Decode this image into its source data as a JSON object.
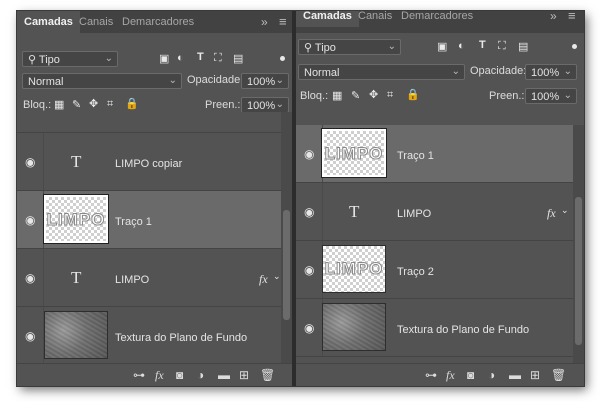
{
  "panel_left": {
    "tabs": [
      "Camadas",
      "Canais",
      "Demarcadores"
    ],
    "collapse": "»",
    "menu": "≡",
    "filter_label": "Tipo",
    "blend_mode": "Normal",
    "opacity_label": "Opacidade:",
    "opacity_value": "100%",
    "lock_label": "Bloq.:",
    "fill_label": "Preen.:",
    "fill_value": "100%",
    "layers": [
      {
        "type": "text",
        "name": "LIMPO copiar",
        "fx": ""
      },
      {
        "type": "image",
        "name": "Traço 1",
        "thumb_text": "LIMPO",
        "selected": true
      },
      {
        "type": "text",
        "name": "LIMPO",
        "fx": "fx"
      },
      {
        "type": "texture",
        "name": "Textura do Plano de Fundo"
      }
    ]
  },
  "panel_right": {
    "tabs": [
      "Camadas",
      "Canais",
      "Demarcadores"
    ],
    "collapse": "»",
    "menu": "≡",
    "filter_label": "Tipo",
    "blend_mode": "Normal",
    "opacity_label": "Opacidade:",
    "opacity_value": "100%",
    "lock_label": "Bloq.:",
    "fill_label": "Preen.:",
    "fill_value": "100%",
    "layers": [
      {
        "type": "image",
        "name": "Traço 1",
        "thumb_text": "LIMPO",
        "selected": true
      },
      {
        "type": "text",
        "name": "LIMPO",
        "fx": "fx"
      },
      {
        "type": "image",
        "name": "Traço 2",
        "thumb_text": "LIMPO"
      },
      {
        "type": "texture",
        "name": "Textura do Plano de Fundo"
      }
    ]
  },
  "glyphs": {
    "search": "⚲",
    "chevron": "⌄",
    "eye": "◉",
    "text_layer": "T",
    "fx": "fx",
    "move": "✥",
    "lock": "🔒"
  }
}
